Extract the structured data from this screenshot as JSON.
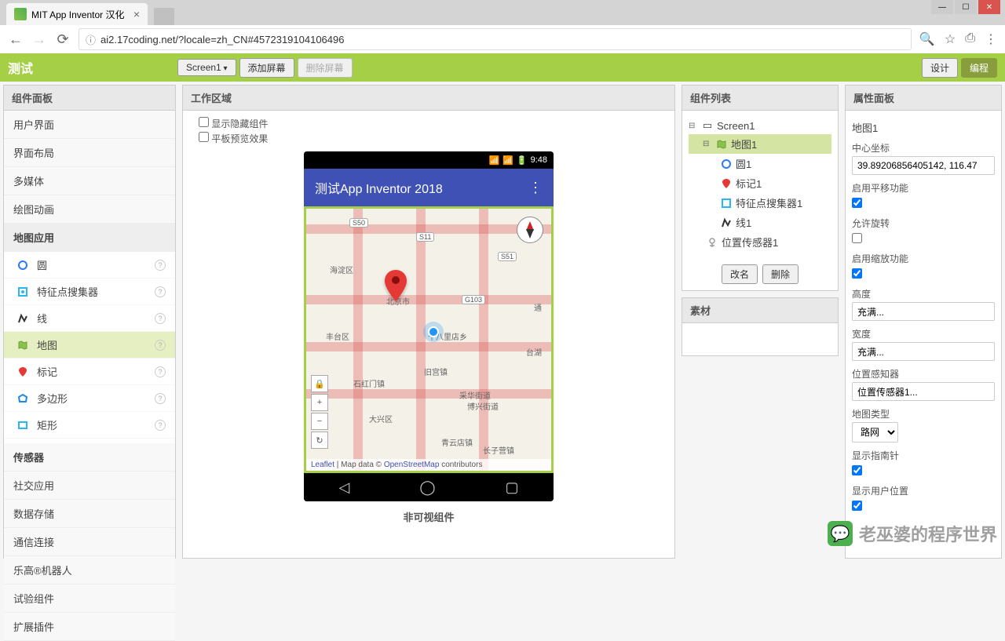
{
  "browser": {
    "tab_title": "MIT App Inventor 汉化",
    "url": "ai2.17coding.net/?locale=zh_CN#4572319104106496"
  },
  "toolbar": {
    "project_name": "测试",
    "screen_dropdown": "Screen1",
    "add_screen": "添加屏幕",
    "remove_screen": "删除屏幕",
    "designer": "设计",
    "blocks": "编程"
  },
  "palette": {
    "header": "组件面板",
    "categories": {
      "ui": "用户界面",
      "layout": "界面布局",
      "media": "多媒体",
      "drawing": "绘图动画",
      "maps": "地图应用",
      "sensors": "传感器",
      "social": "社交应用",
      "storage": "数据存储",
      "connectivity": "通信连接",
      "lego": "乐高®机器人",
      "experimental": "试验组件",
      "extension": "扩展插件"
    },
    "map_items": {
      "circle": "圆",
      "feature": "特征点搜集器",
      "line": "线",
      "map": "地图",
      "marker": "标记",
      "polygon": "多边形",
      "rectangle": "矩形"
    }
  },
  "viewer": {
    "header": "工作区域",
    "show_hidden": "显示隐藏组件",
    "tablet_preview": "平板预览效果",
    "phone_time": "9:48",
    "app_title": "测试App Inventor 2018",
    "map_attribution_leaflet": "Leaflet",
    "map_attribution_mid": " | Map data © ",
    "map_attribution_osm": "OpenStreetMap",
    "map_attribution_end": " contributors",
    "non_visual": "非可视组件",
    "area_haidian": "海淀区",
    "area_fengtai": "丰台区",
    "area_daxing": "大兴区",
    "area_tongzhou": "通",
    "area_taihu": "台湖",
    "area_beijing": "北京市",
    "area_shibalidian": "十八里店乡",
    "area_jiugong": "旧宫镇",
    "area_shilihe": "石红门镇",
    "area_chariying": "长子营镇",
    "area_caiyu": "采华街道",
    "area_boxing": "博兴街道",
    "area_qingyundian": "青云店镇",
    "road_s50": "S50",
    "road_s11": "S11",
    "road_s51": "S51",
    "road_g103": "G103"
  },
  "components": {
    "header": "组件列表",
    "tree": {
      "screen": "Screen1",
      "map": "地图1",
      "circle": "圆1",
      "marker": "标记1",
      "feature": "特征点搜集器1",
      "line": "线1",
      "location": "位置传感器1"
    },
    "rename": "改名",
    "delete": "删除",
    "media_header": "素材"
  },
  "properties": {
    "header": "属性面板",
    "component_name": "地图1",
    "center_label": "中心坐标",
    "center_value": "39.89206856405142, 116.47",
    "pan_label": "启用平移功能",
    "rotate_label": "允许旋转",
    "zoom_label": "启用缩放功能",
    "height_label": "高度",
    "height_value": "充满...",
    "width_label": "宽度",
    "width_value": "充满...",
    "location_sensor_label": "位置感知器",
    "location_sensor_value": "位置传感器1...",
    "map_type_label": "地图类型",
    "map_type_value": "路网",
    "show_compass_label": "显示指南针",
    "show_user_label": "显示用户位置"
  },
  "watermark": "老巫婆的程序世界"
}
